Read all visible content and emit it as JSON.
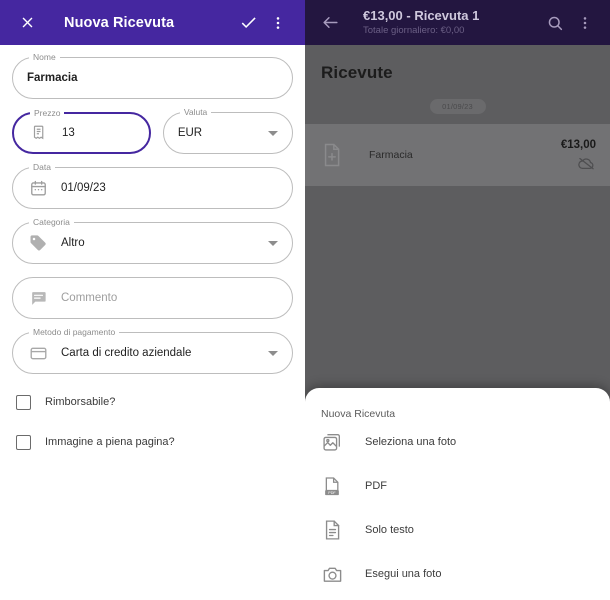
{
  "left": {
    "appbar": {
      "close_icon": "close-icon",
      "title": "Nuova Ricevuta",
      "confirm_icon": "check-icon",
      "overflow_icon": "more-vertical-icon"
    },
    "fields": [
      {
        "key": "nome",
        "label": "Nome",
        "value": "Farmacia",
        "placeholder": "",
        "icon": "",
        "caret": false,
        "focused": false,
        "bold": true
      },
      {
        "key": "prezzo",
        "label": "Prezzo",
        "value": "13",
        "placeholder": "",
        "icon": "receipt-icon",
        "caret": false,
        "focused": true,
        "bold": false
      },
      {
        "key": "valuta",
        "label": "Valuta",
        "value": "EUR",
        "placeholder": "",
        "icon": "",
        "caret": true,
        "focused": false,
        "bold": false
      },
      {
        "key": "data",
        "label": "Data",
        "value": "01/09/23",
        "placeholder": "",
        "icon": "calendar-icon",
        "caret": false,
        "focused": false,
        "bold": false
      },
      {
        "key": "categoria",
        "label": "Categoria",
        "value": "Altro",
        "placeholder": "",
        "icon": "tag-icon",
        "caret": true,
        "focused": false,
        "bold": false
      },
      {
        "key": "commento",
        "label": "",
        "value": "",
        "placeholder": "Commento",
        "icon": "comment-icon",
        "caret": false,
        "focused": false,
        "bold": false
      },
      {
        "key": "metodo",
        "label": "Metodo di pagamento",
        "value": "Carta di credito aziendale",
        "placeholder": "",
        "icon": "credit-card-icon",
        "caret": true,
        "focused": false,
        "bold": false
      }
    ],
    "checkboxes": [
      {
        "label": "Rimborsabile?",
        "checked": false
      },
      {
        "label": "Immagine a piena pagina?",
        "checked": false
      }
    ]
  },
  "right": {
    "appbar": {
      "back_icon": "arrow-back-icon",
      "title": "€13,00 - Ricevuta 1",
      "subtitle": "Totale giornaliero: €0,00",
      "search_icon": "search-icon",
      "overflow_icon": "more-vertical-icon"
    },
    "heading": "Ricevute",
    "date_chip": "01/09/23",
    "receipt": {
      "thumb_icon": "add-document-icon",
      "name": "Farmacia",
      "amount": "€13,00",
      "sync_icon": "cloud-off-icon"
    }
  },
  "sheet": {
    "title": "Nuova Ricevuta",
    "items": [
      {
        "label": "Seleziona una foto",
        "icon": "image-icon"
      },
      {
        "label": "PDF",
        "icon": "pdf-icon"
      },
      {
        "label": "Solo testo",
        "icon": "document-icon"
      },
      {
        "label": "Esegui una foto",
        "icon": "camera-icon"
      }
    ]
  },
  "colors": {
    "primary": "#4527a0",
    "primary_dim": "#231640",
    "scrim": "#5d5d5f",
    "card": "#727274"
  }
}
